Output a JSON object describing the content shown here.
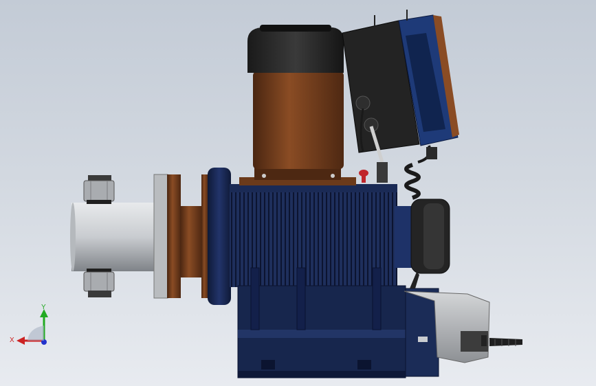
{
  "viewport": {
    "background_top": "#c3cbd6",
    "background_bottom": "#e8ebf0"
  },
  "model": {
    "name": "dosing-pump-assembly",
    "colors": {
      "navy_body": "#1b2c57",
      "navy_dark": "#0f1a38",
      "bronze": "#6b3a1a",
      "bronze_light": "#8a4c24",
      "black_cap": "#232323",
      "steel": "#c9ccd0",
      "grey_box": "#b9bcc0",
      "red_knob": "#c0262b"
    }
  },
  "triad": {
    "x_label": "X",
    "y_label": "Y",
    "x_color": "#cc2222",
    "y_color": "#22aa22",
    "z_color": "#2233cc"
  }
}
